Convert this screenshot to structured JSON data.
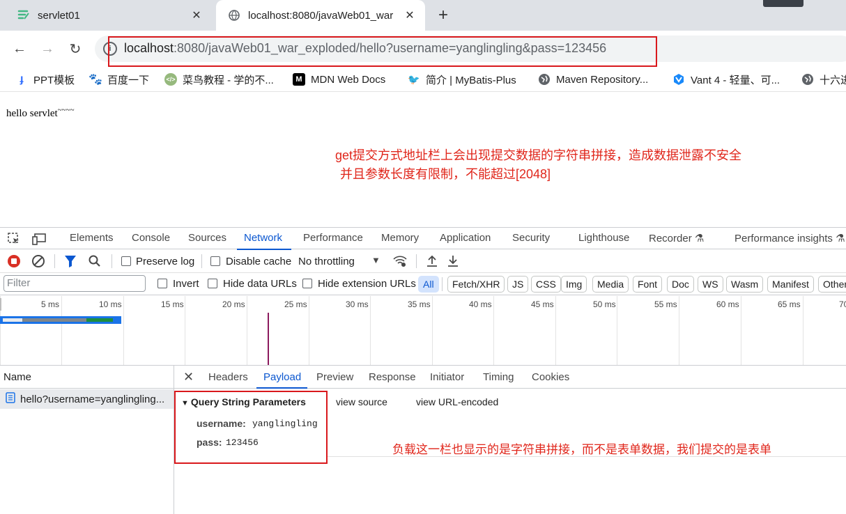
{
  "browser": {
    "tabs": [
      {
        "title": "servlet01",
        "icon": "leaf-icon",
        "active": false
      },
      {
        "title": "localhost:8080/javaWeb01_war",
        "icon": "globe-icon",
        "active": true
      }
    ],
    "new_tab_symbol": "+",
    "close_symbol": "✕",
    "nav": {
      "back": "←",
      "forward": "→",
      "reload": "↻"
    },
    "url": {
      "host": "localhost",
      "rest": ":8080/javaWeb01_war_exploded/hello?username=yanglingling&pass=123456",
      "info_symbol": "i"
    },
    "bookmarks": [
      {
        "label": "PPT模板",
        "icon": "ppt-icon",
        "color": "#3370ff"
      },
      {
        "label": "百度一下",
        "icon": "baidu-paw-icon",
        "color": "#2932e1"
      },
      {
        "label": "菜鸟教程 - 学的不...",
        "icon": "runoob-icon",
        "color": "#96b97d"
      },
      {
        "label": "MDN Web Docs",
        "icon": "mdn-icon",
        "color": "#000000"
      },
      {
        "label": "简介 | MyBatis-Plus",
        "icon": "mybatis-bird-icon",
        "color": "#1f2937"
      },
      {
        "label": "Maven Repository...",
        "icon": "globe-icon",
        "color": "#5f6368"
      },
      {
        "label": "Vant 4 - 轻量、可...",
        "icon": "vant-icon",
        "color": "#1989fa"
      },
      {
        "label": "十六进",
        "icon": "globe-icon",
        "color": "#5f6368"
      }
    ]
  },
  "page": {
    "hello_text": "hello servlet",
    "hello_suffix": "~~~~",
    "annotation_line1": "get提交方式地址栏上会出现提交数据的字符串拼接，造成数据泄露不安全",
    "annotation_line2": "并且参数长度有限制，不能超过[2048]",
    "annotation_payload": "负载这一栏也显示的是字符串拼接，而不是表单数据，我们提交的是表单"
  },
  "devtools": {
    "tabs": [
      "Elements",
      "Console",
      "Sources",
      "Network",
      "Performance",
      "Memory",
      "Application",
      "Security",
      "Lighthouse",
      "Recorder",
      "Performance insights"
    ],
    "active_tab": "Network",
    "toolbar": {
      "preserve_log": "Preserve log",
      "disable_cache": "Disable cache",
      "throttling": "No throttling"
    },
    "filter": {
      "placeholder": "Filter",
      "invert": "Invert",
      "hide_data_urls": "Hide data URLs",
      "hide_extension_urls": "Hide extension URLs",
      "types": [
        "All",
        "Fetch/XHR",
        "JS",
        "CSS",
        "Img",
        "Media",
        "Font",
        "Doc",
        "WS",
        "Wasm",
        "Manifest",
        "Other"
      ],
      "active_type": "All"
    },
    "timeline_ticks": [
      "5 ms",
      "10 ms",
      "15 ms",
      "20 ms",
      "25 ms",
      "30 ms",
      "35 ms",
      "40 ms",
      "45 ms",
      "50 ms",
      "55 ms",
      "60 ms",
      "65 ms",
      "70"
    ],
    "name_header": "Name",
    "request_name": "hello?username=yanglingling...",
    "detail_tabs": [
      "Headers",
      "Payload",
      "Preview",
      "Response",
      "Initiator",
      "Timing",
      "Cookies"
    ],
    "active_detail_tab": "Payload",
    "payload": {
      "section_title": "Query String Parameters",
      "view_source": "view source",
      "view_url_encoded": "view URL-encoded",
      "params": [
        {
          "key": "username:",
          "value": "yanglingling"
        },
        {
          "key": "pass:",
          "value": "123456"
        }
      ]
    }
  },
  "colors": {
    "annotation": "#e0261b",
    "accent_blue": "#0b57d0",
    "record_red": "#d93025"
  }
}
